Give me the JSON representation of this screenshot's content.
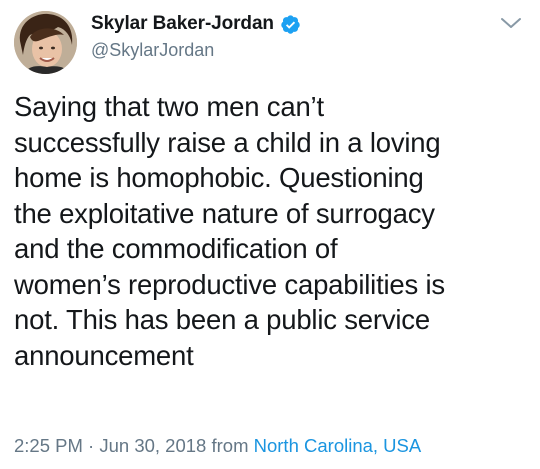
{
  "user": {
    "display_name": "Skylar Baker-Jordan",
    "handle": "@SkylarJordan",
    "verified_icon": "verified-badge-icon"
  },
  "tweet": {
    "lines": [
      "Saying that two men can’t",
      "successfully raise a child in a loving",
      "home is homophobic. Questioning",
      "the exploitative nature of surrogacy",
      "and the commodification of",
      "women’s reproductive capabilities is",
      "not. This has been a public service",
      "announcement"
    ]
  },
  "meta": {
    "time": "2:25 PM",
    "separator": "·",
    "date": "Jun 30, 2018",
    "from_label": "from",
    "location": "North Carolina, USA"
  },
  "colors": {
    "accent": "#1da1f2",
    "link": "#1b95e0",
    "secondary_text": "#657786",
    "primary_text": "#14171a"
  }
}
